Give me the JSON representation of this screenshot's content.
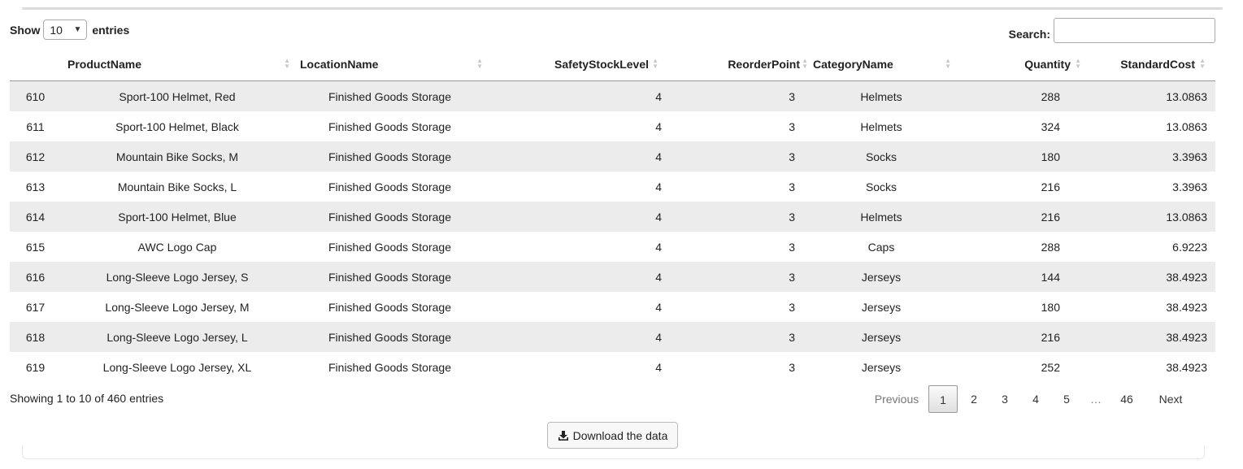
{
  "length_control": {
    "show_label": "Show",
    "selected": "10",
    "entries_label": "entries"
  },
  "search": {
    "label": "Search:",
    "value": "",
    "placeholder": ""
  },
  "table": {
    "columns": [
      "ProductName",
      "LocationName",
      "SafetyStockLevel",
      "ReorderPoint",
      "CategoryName",
      "Quantity",
      "StandardCost"
    ],
    "rows": [
      {
        "id": "610",
        "product": "Sport-100 Helmet, Red",
        "location": "Finished Goods Storage",
        "safety": "4",
        "reorder": "3",
        "category": "Helmets",
        "qty": "288",
        "cost": "13.0863"
      },
      {
        "id": "611",
        "product": "Sport-100 Helmet, Black",
        "location": "Finished Goods Storage",
        "safety": "4",
        "reorder": "3",
        "category": "Helmets",
        "qty": "324",
        "cost": "13.0863"
      },
      {
        "id": "612",
        "product": "Mountain Bike Socks, M",
        "location": "Finished Goods Storage",
        "safety": "4",
        "reorder": "3",
        "category": "Socks",
        "qty": "180",
        "cost": "3.3963"
      },
      {
        "id": "613",
        "product": "Mountain Bike Socks, L",
        "location": "Finished Goods Storage",
        "safety": "4",
        "reorder": "3",
        "category": "Socks",
        "qty": "216",
        "cost": "3.3963"
      },
      {
        "id": "614",
        "product": "Sport-100 Helmet, Blue",
        "location": "Finished Goods Storage",
        "safety": "4",
        "reorder": "3",
        "category": "Helmets",
        "qty": "216",
        "cost": "13.0863"
      },
      {
        "id": "615",
        "product": "AWC Logo Cap",
        "location": "Finished Goods Storage",
        "safety": "4",
        "reorder": "3",
        "category": "Caps",
        "qty": "288",
        "cost": "6.9223"
      },
      {
        "id": "616",
        "product": "Long-Sleeve Logo Jersey, S",
        "location": "Finished Goods Storage",
        "safety": "4",
        "reorder": "3",
        "category": "Jerseys",
        "qty": "144",
        "cost": "38.4923"
      },
      {
        "id": "617",
        "product": "Long-Sleeve Logo Jersey, M",
        "location": "Finished Goods Storage",
        "safety": "4",
        "reorder": "3",
        "category": "Jerseys",
        "qty": "180",
        "cost": "38.4923"
      },
      {
        "id": "618",
        "product": "Long-Sleeve Logo Jersey, L",
        "location": "Finished Goods Storage",
        "safety": "4",
        "reorder": "3",
        "category": "Jerseys",
        "qty": "216",
        "cost": "38.4923"
      },
      {
        "id": "619",
        "product": "Long-Sleeve Logo Jersey, XL",
        "location": "Finished Goods Storage",
        "safety": "4",
        "reorder": "3",
        "category": "Jerseys",
        "qty": "252",
        "cost": "38.4923"
      }
    ]
  },
  "info": "Showing 1 to 10 of 460 entries",
  "pagination": {
    "previous": "Previous",
    "pages": [
      "1",
      "2",
      "3",
      "4",
      "5"
    ],
    "current": "1",
    "ellipsis": "…",
    "last": "46",
    "next": "Next"
  },
  "download_button": {
    "label": "Download the data",
    "icon": "download-icon"
  }
}
